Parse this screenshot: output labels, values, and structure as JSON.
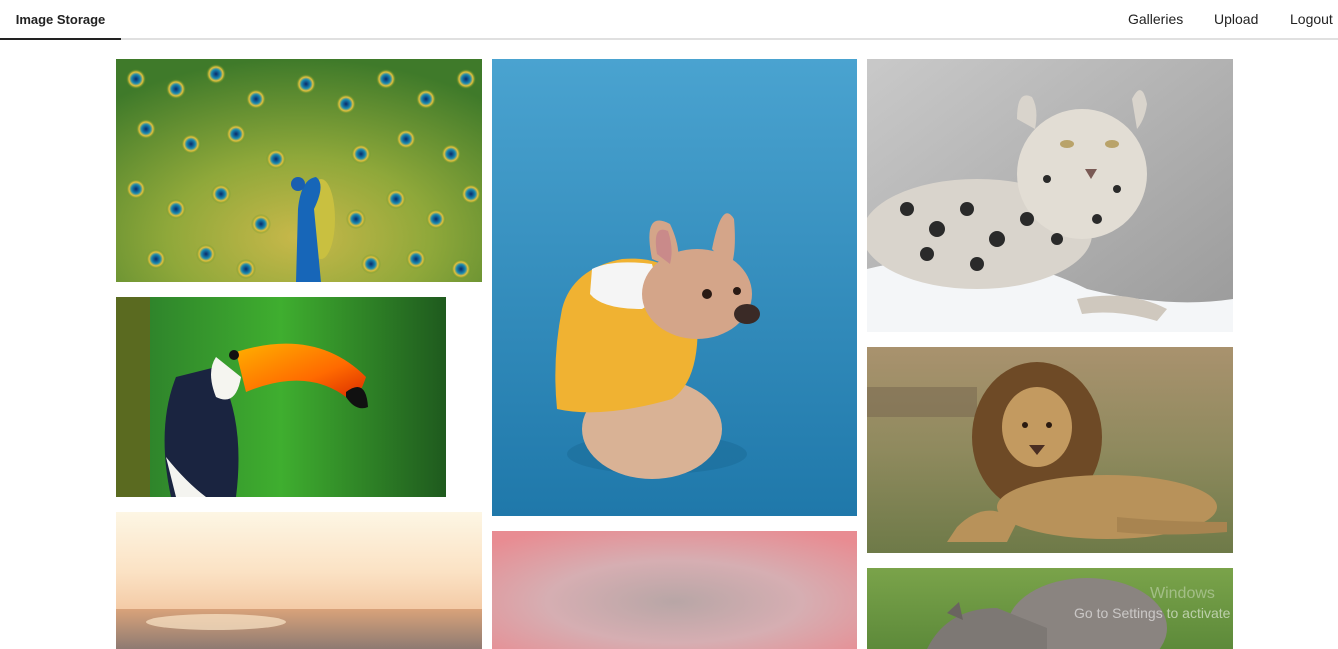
{
  "nav": {
    "brand": "Image Storage",
    "links": [
      {
        "label": "Galleries"
      },
      {
        "label": "Upload"
      },
      {
        "label": "Logout"
      }
    ]
  },
  "gallery": {
    "images": [
      {
        "subject": "peacock"
      },
      {
        "subject": "toucan"
      },
      {
        "subject": "sunset-sea"
      },
      {
        "subject": "french-bulldog"
      },
      {
        "subject": "blurred-pink"
      },
      {
        "subject": "snow-leopard"
      },
      {
        "subject": "lion"
      },
      {
        "subject": "rhinoceros"
      }
    ]
  },
  "overlay": {
    "activation_line1": "Windows",
    "activation_line2": "Go to Settings to activate Windows."
  },
  "colors": {
    "nav_border": "#e0e0e0",
    "active_underline": "#222222"
  }
}
